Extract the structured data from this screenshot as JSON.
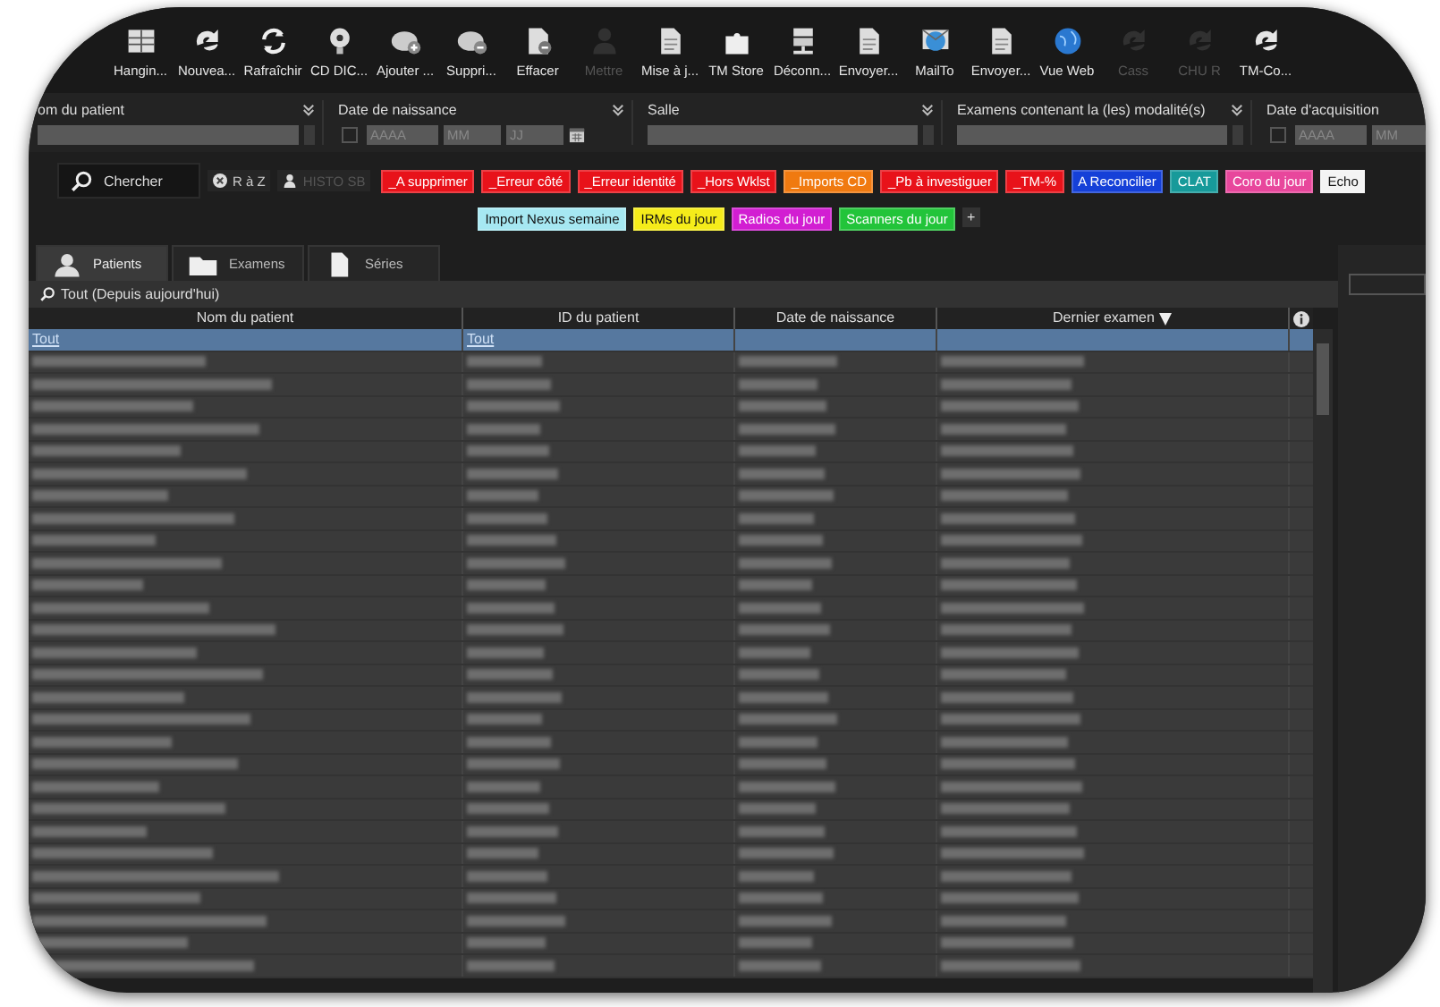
{
  "toolbar": [
    {
      "label": "Hangin...",
      "disabled": false
    },
    {
      "label": "Nouvea...",
      "disabled": false
    },
    {
      "label": "Rafraîchir",
      "disabled": false
    },
    {
      "label": "CD DIC...",
      "disabled": false
    },
    {
      "label": "Ajouter ...",
      "disabled": false
    },
    {
      "label": "Suppri...",
      "disabled": false
    },
    {
      "label": "Effacer",
      "disabled": false
    },
    {
      "label": "Mettre",
      "disabled": true
    },
    {
      "label": "Mise à j...",
      "disabled": false
    },
    {
      "label": "TM Store",
      "disabled": false
    },
    {
      "label": "Déconn...",
      "disabled": false
    },
    {
      "label": "Envoyer...",
      "disabled": false
    },
    {
      "label": "MailTo",
      "disabled": false
    },
    {
      "label": "Envoyer...",
      "disabled": false
    },
    {
      "label": "Vue Web",
      "disabled": false
    },
    {
      "label": "Cass",
      "disabled": true
    },
    {
      "label": "CHU R",
      "disabled": true
    },
    {
      "label": "TM-Co...",
      "disabled": false
    }
  ],
  "filters": [
    {
      "label": "om du patient",
      "kind": "text"
    },
    {
      "label": "Date de naissance",
      "kind": "date",
      "checked": false,
      "placeholders": [
        "AAAA",
        "MM",
        "JJ"
      ]
    },
    {
      "label": "Salle",
      "kind": "text"
    },
    {
      "label": "Examens contenant la (les) modalité(s)",
      "kind": "text"
    },
    {
      "label": "Date d'acquisition",
      "kind": "date",
      "checked": false,
      "placeholders": [
        "AAAA",
        "MM"
      ]
    }
  ],
  "search_button": "Chercher",
  "reset_button": "R à Z",
  "histo_button": {
    "label": "HISTO SB",
    "disabled": true
  },
  "tag_rows": [
    [
      {
        "label": "_A supprimer",
        "color": "#e8121a"
      },
      {
        "label": "_Erreur côté",
        "color": "#e8121a"
      },
      {
        "label": "_Erreur identité",
        "color": "#e8121a"
      },
      {
        "label": "_Hors Wklst",
        "color": "#e8121a"
      },
      {
        "label": "_Imports CD",
        "color": "#f07a10"
      },
      {
        "label": "_Pb à investiguer",
        "color": "#e8121a"
      },
      {
        "label": "_TM-%",
        "color": "#e8121a"
      },
      {
        "label": "A Reconcilier",
        "color": "#1540d8"
      },
      {
        "label": "CLAT",
        "color": "#179a9a"
      },
      {
        "label": "Coro du jour",
        "color": "#e8479c"
      },
      {
        "label": "Echo",
        "color": "#f4f4f4"
      }
    ],
    [
      {
        "label": "Import Nexus semaine",
        "color": "#a6e8f2"
      },
      {
        "label": "IRMs du jour",
        "color": "#f5ec1a"
      },
      {
        "label": "Radios du jour",
        "color": "#d21ed2"
      },
      {
        "label": "Scanners du jour",
        "color": "#22c43a"
      }
    ]
  ],
  "add_tag_button": "+",
  "tabs": [
    {
      "label": "Patients",
      "selected": true
    },
    {
      "label": "Examens",
      "selected": false
    },
    {
      "label": "Séries",
      "selected": false
    }
  ],
  "filter_title": "Tout (Depuis aujourd'hui)",
  "table": {
    "columns": [
      {
        "label": "Nom du patient",
        "sorted": false
      },
      {
        "label": "ID du patient",
        "sorted": false
      },
      {
        "label": "Date de naissance",
        "sorted": false
      },
      {
        "label": "Dernier examen",
        "sorted": true
      }
    ],
    "rows": [
      {
        "kind": "text",
        "selected": true,
        "cells": [
          "Tout",
          "Tout"
        ]
      },
      {
        "kind": "blurred",
        "selected": false
      },
      {
        "kind": "blurred",
        "selected": false
      },
      {
        "kind": "blurred",
        "selected": false
      },
      {
        "kind": "blurred",
        "selected": false
      },
      {
        "kind": "blurred",
        "selected": false
      },
      {
        "kind": "blurred",
        "selected": false
      },
      {
        "kind": "blurred",
        "selected": false
      },
      {
        "kind": "blurred",
        "selected": false
      },
      {
        "kind": "blurred",
        "selected": false
      },
      {
        "kind": "blurred",
        "selected": false
      },
      {
        "kind": "blurred",
        "selected": false
      },
      {
        "kind": "blurred",
        "selected": false
      },
      {
        "kind": "blurred",
        "selected": false
      },
      {
        "kind": "blurred",
        "selected": false
      },
      {
        "kind": "blurred",
        "selected": false
      },
      {
        "kind": "blurred",
        "selected": false
      },
      {
        "kind": "blurred",
        "selected": false
      },
      {
        "kind": "blurred",
        "selected": false
      },
      {
        "kind": "blurred",
        "selected": false
      },
      {
        "kind": "blurred",
        "selected": false
      },
      {
        "kind": "blurred",
        "selected": false
      },
      {
        "kind": "blurred",
        "selected": false
      },
      {
        "kind": "blurred",
        "selected": false
      },
      {
        "kind": "blurred",
        "selected": false
      },
      {
        "kind": "blurred",
        "selected": false
      },
      {
        "kind": "blurred",
        "selected": false
      },
      {
        "kind": "blurred",
        "selected": false
      },
      {
        "kind": "blurred",
        "selected": false
      }
    ]
  }
}
